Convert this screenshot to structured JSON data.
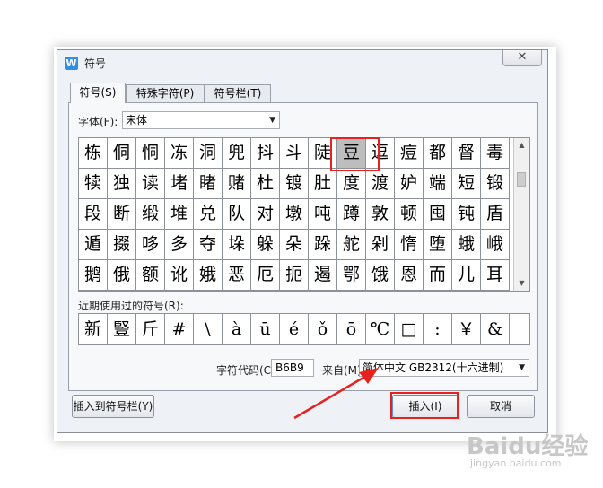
{
  "window": {
    "title": "符号",
    "app_icon_letter": "W",
    "close_glyph": "✕"
  },
  "tabs": [
    {
      "label": "符号(S)",
      "active": true
    },
    {
      "label": "特殊字符(P)",
      "active": false
    },
    {
      "label": "符号栏(T)",
      "active": false
    }
  ],
  "font": {
    "label": "字体(F):",
    "value": "宋体"
  },
  "symbol_grid": [
    [
      "栋",
      "侗",
      "恫",
      "冻",
      "洞",
      "兜",
      "抖",
      "斗",
      "陡",
      "豆",
      "逗",
      "痘",
      "都",
      "督",
      "毒"
    ],
    [
      "犊",
      "独",
      "读",
      "堵",
      "睹",
      "赌",
      "杜",
      "镀",
      "肚",
      "度",
      "渡",
      "妒",
      "端",
      "短",
      "锻"
    ],
    [
      "段",
      "断",
      "缎",
      "堆",
      "兑",
      "队",
      "对",
      "墩",
      "吨",
      "蹲",
      "敦",
      "顿",
      "囤",
      "钝",
      "盾"
    ],
    [
      "遁",
      "掇",
      "哆",
      "多",
      "夺",
      "垛",
      "躲",
      "朵",
      "跺",
      "舵",
      "剁",
      "惰",
      "堕",
      "蛾",
      "峨"
    ],
    [
      "鹅",
      "俄",
      "额",
      "讹",
      "娥",
      "恶",
      "厄",
      "扼",
      "遏",
      "鄂",
      "饿",
      "恩",
      "而",
      "儿",
      "耳"
    ]
  ],
  "selected_char": "豆",
  "recent": {
    "label": "近期使用过的符号(R):",
    "items": [
      "新",
      "豎",
      "斤",
      "#",
      "\\",
      "à",
      "ū",
      "é",
      "ǒ",
      "ō",
      "℃",
      "□",
      ":",
      "￥",
      "&"
    ]
  },
  "char_code": {
    "label": "字符代码(C):",
    "value": "B6B9"
  },
  "from": {
    "label": "来自(M)",
    "value": "简体中文 GB2312(十六进制)"
  },
  "buttons": {
    "insert_to_bar": "插入到符号栏(Y)",
    "insert": "插入(I)",
    "cancel": "取消"
  },
  "watermark": {
    "main": "Baidu经验",
    "sub": "jingyan.baidu.com"
  },
  "colors": {
    "highlight": "#e8201e",
    "selected_cell": "#bdbdbd",
    "app_icon": "#2f8fe8"
  }
}
